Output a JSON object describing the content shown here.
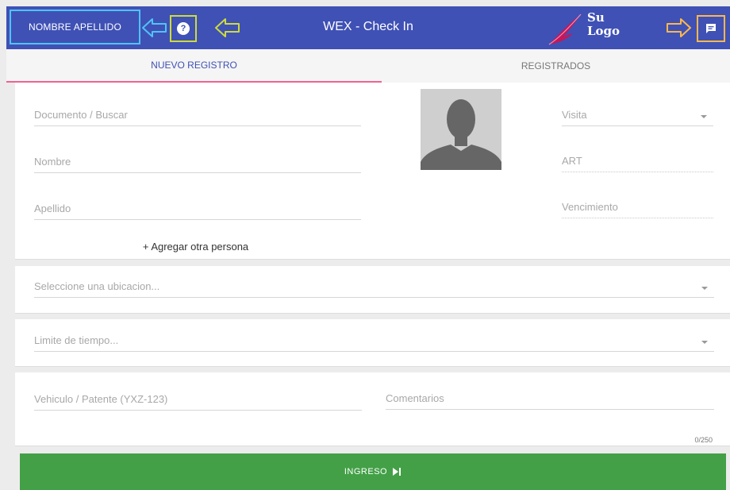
{
  "header": {
    "user_label": "NOMBRE APELLIDO",
    "help_symbol": "?",
    "title": "WEX - Check In",
    "logo_line1": "Su",
    "logo_line2": "Logo",
    "colors": {
      "bar": "#3f51b5",
      "user_outline": "#4fc3f7",
      "help_outline": "#cddc39",
      "chat_outline": "#ffb74d"
    }
  },
  "tabs": [
    {
      "label": "NUEVO REGISTRO",
      "active": true
    },
    {
      "label": "REGISTRADOS",
      "active": false
    }
  ],
  "person": {
    "documento_placeholder": "Documento / Buscar",
    "nombre_placeholder": "Nombre",
    "apellido_placeholder": "Apellido",
    "visita_placeholder": "Visita",
    "art_placeholder": "ART",
    "vencimiento_placeholder": "Vencimiento",
    "add_person_label": "+ Agregar otra persona"
  },
  "location": {
    "placeholder": "Seleccione una ubicacion..."
  },
  "time_limit": {
    "placeholder": "Limite de tiempo..."
  },
  "vehicle": {
    "placeholder": "Vehiculo / Patente (YXZ-123)",
    "comments_placeholder": "Comentarios",
    "counter": "0/250"
  },
  "submit": {
    "label": "INGRESO",
    "icon": "skip-next-icon",
    "color": "#43a047"
  }
}
